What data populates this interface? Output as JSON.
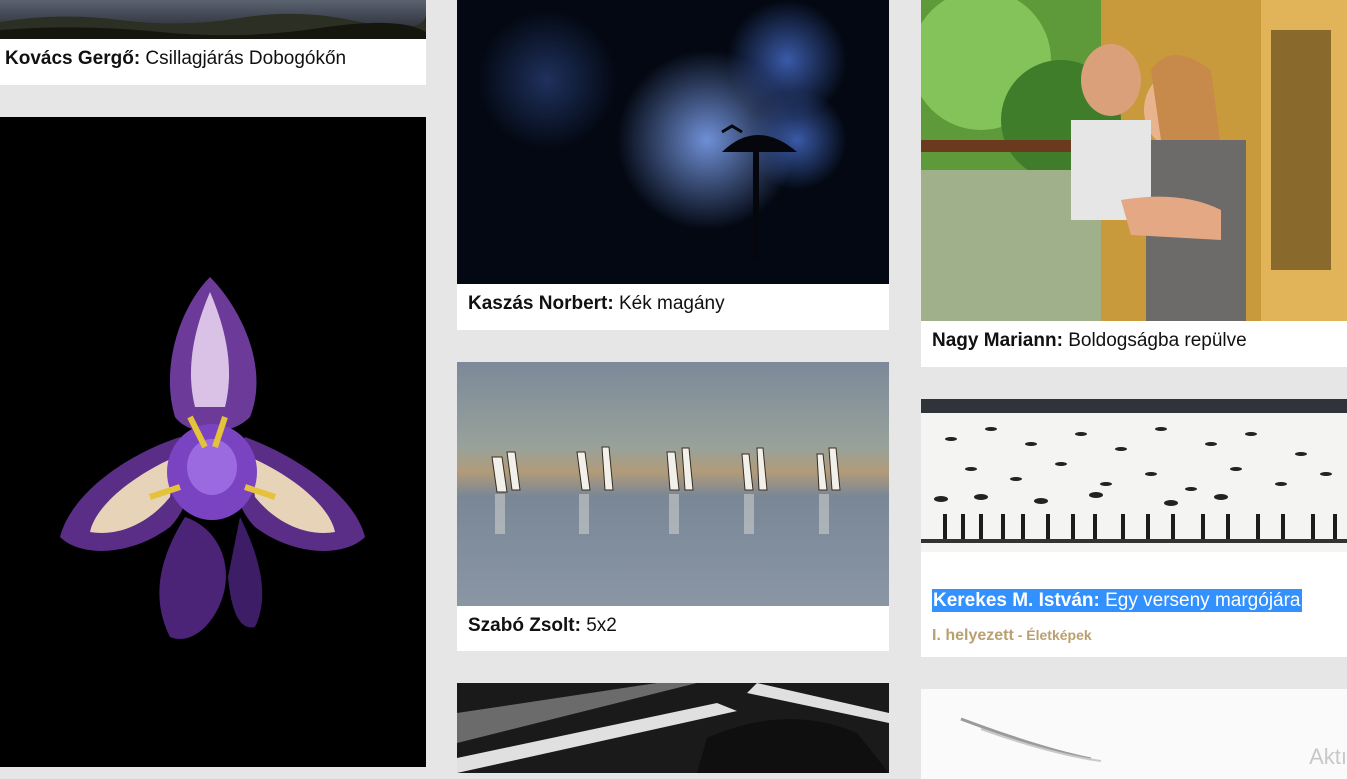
{
  "cards": [
    {
      "author": "Kovács Gergő:",
      "title": " Csillagjárás Dobogókőn"
    },
    {
      "author": "",
      "title": ""
    },
    {
      "author": "Kaszás Norbert:",
      "title": " Kék magány"
    },
    {
      "author": "Szabó Zsolt:",
      "title": " 5x2"
    },
    {
      "author": "",
      "title": ""
    },
    {
      "author": "Nagy Mariann:",
      "title": " Boldogságba repülve"
    },
    {
      "author": "Kerekes M. István:",
      "title": " Egy verseny margójára",
      "award": "I. helyezett",
      "award_sep": " - ",
      "category": "Életképek"
    },
    {
      "partial_text": "Aktı"
    }
  ],
  "colors": {
    "background": "#e6e6e6",
    "card": "#ffffff",
    "selection": "#3390ff",
    "award": "#b9a071"
  }
}
